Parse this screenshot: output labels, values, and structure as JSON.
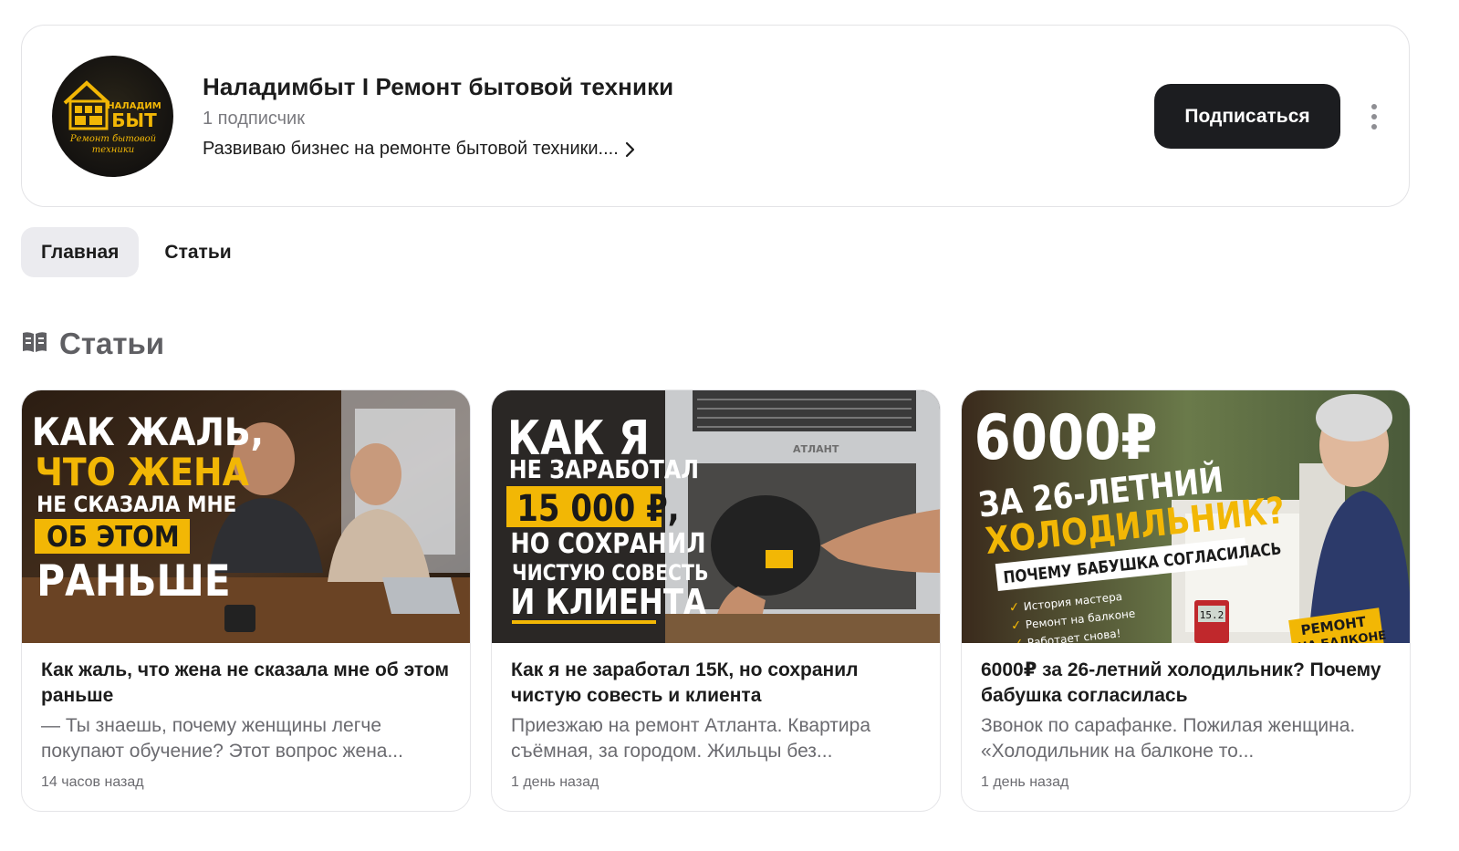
{
  "channel": {
    "title": "Наладимбыт I Ремонт бытовой техники",
    "subscribers": "1 подписчик",
    "description": "Развиваю бизнес на ремонте бытовой техники....",
    "subscribe_label": "Подписаться",
    "logo": {
      "line1": "НАЛАДИМ",
      "line2": "БЫТ",
      "line3": "Ремонт бытовой",
      "line4": "техники"
    }
  },
  "tabs": [
    {
      "label": "Главная",
      "active": true
    },
    {
      "label": "Статьи",
      "active": false
    }
  ],
  "section": {
    "title": "Статьи",
    "icon": "book-icon"
  },
  "articles": [
    {
      "title": "Как жаль, что жена не сказала мне об этом раньше",
      "excerpt": "— Ты знаешь, почему женщины легче покупают обучение? Этот вопрос жена...",
      "time": "14 часов назад",
      "poster": {
        "line1": "КАК ЖАЛЬ,",
        "line2": "ЧТО ЖЕНА",
        "line3": "НЕ СКАЗАЛА МНЕ",
        "line4": "ОБ ЭТОМ",
        "line5": "РАНЬШЕ"
      }
    },
    {
      "title": "Как я не заработал 15К, но сохранил чистую совесть и клиента",
      "excerpt": "Приезжаю на ремонт Атланта. Квартира съёмная, за городом. Жильцы без...",
      "time": "1 день назад",
      "poster": {
        "line1": "КАК Я",
        "line2": "НЕ ЗАРАБОТАЛ",
        "line3": "15 000 ₽,",
        "line4": "НО СОХРАНИЛ",
        "line5": "ЧИСТУЮ СОВЕСТЬ",
        "line6": "И КЛИЕНТА",
        "brand": "АТЛАНТ"
      }
    },
    {
      "title": "6000₽ за 26-летний холодильник? Почему бабушка согласилась",
      "excerpt": "Звонок по сарафанке. Пожилая женщина. «Холодильник на балконе то...",
      "time": "1 день назад",
      "poster": {
        "line1": "6000₽",
        "line2": "ЗА 26-ЛЕТНИЙ",
        "line3": "ХОЛОДИЛЬНИК?",
        "line4": "ПОЧЕМУ БАБУШКА СОГЛАСИЛАСЬ",
        "bullet1": "История мастера",
        "bullet2": "Ремонт на балконе",
        "bullet3": "Работает снова!",
        "tag": "РЕМОНТ",
        "tag2": "НА БАЛКОНЕ",
        "meter": "15.2"
      }
    }
  ],
  "colors": {
    "accent_yellow": "#f2b705",
    "button_dark": "#1c1d20",
    "tab_active_bg": "#ebebef",
    "muted_text": "#6b6b70"
  }
}
